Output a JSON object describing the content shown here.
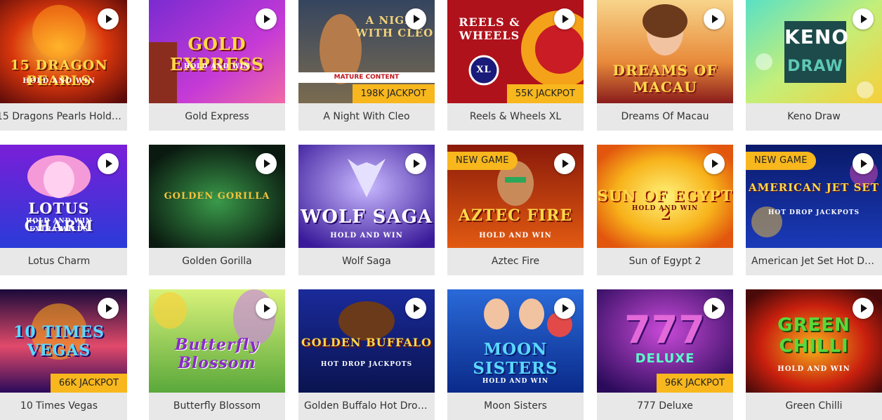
{
  "colors": {
    "tile_bg": "#e8e8e8",
    "badge": "#f7b71d",
    "text": "#333333"
  },
  "play_icon": "play-circle-icon",
  "games": [
    {
      "id": "g1",
      "title": "15 Dragons Pearls Hold a...",
      "art": "15 DRAGON PEARLS",
      "art_sub": "HOLD AND WIN"
    },
    {
      "id": "g2",
      "title": "Gold Express",
      "art": "GOLD EXPRESS",
      "art_sub": "HOLD AND WIN"
    },
    {
      "id": "g3",
      "title": "A Night With Cleo",
      "art": "A NIGHT WITH CLEO",
      "jackpot": "198K JACKPOT",
      "mature": "MATURE CONTENT"
    },
    {
      "id": "g4",
      "title": "Reels & Wheels XL",
      "art": "REELS & WHEELS",
      "art_sub": "XL",
      "jackpot": "55K JACKPOT"
    },
    {
      "id": "g5",
      "title": "Dreams Of Macau",
      "art": "DREAMS OF MACAU"
    },
    {
      "id": "g6",
      "title": "Keno Draw",
      "art": "KENO",
      "art_sub": "DRAW"
    },
    {
      "id": "g7",
      "title": "Lotus Charm",
      "art": "LOTUS CHARM",
      "art_sub": "HOLD AND WIN",
      "art_sub2": "EXTRA WILDS"
    },
    {
      "id": "g8",
      "title": "Golden Gorilla",
      "art": "GOLDEN GORILLA"
    },
    {
      "id": "g9",
      "title": "Wolf Saga",
      "art": "WOLF SAGA",
      "art_sub": "HOLD AND WIN"
    },
    {
      "id": "g10",
      "title": "Aztec Fire",
      "art": "AZTEC FIRE",
      "art_sub": "HOLD AND WIN",
      "new": "NEW GAME"
    },
    {
      "id": "g11",
      "title": "Sun of Egypt 2",
      "art": "SUN OF EGYPT 2",
      "art_sub": "HOLD AND WIN"
    },
    {
      "id": "g12",
      "title": "American Jet Set Hot Dr...",
      "art": "AMERICAN JET SET",
      "art_sub": "HOT DROP JACKPOTS",
      "new": "NEW GAME"
    },
    {
      "id": "g13",
      "title": "10 Times Vegas",
      "art": "10 TIMES VEGAS",
      "jackpot": "66K JACKPOT"
    },
    {
      "id": "g14",
      "title": "Butterfly Blossom",
      "art": "Butterfly Blossom"
    },
    {
      "id": "g15",
      "title": "Golden Buffalo Hot Drop...",
      "art": "GOLDEN BUFFALO",
      "art_sub": "HOT DROP JACKPOTS"
    },
    {
      "id": "g16",
      "title": "Moon Sisters",
      "art": "MOON SISTERS",
      "art_sub": "HOLD AND WIN"
    },
    {
      "id": "g17",
      "title": "777 Deluxe",
      "art": "777",
      "art_sub": "DELUXE",
      "jackpot": "96K JACKPOT"
    },
    {
      "id": "g18",
      "title": "Green Chilli",
      "art": "GREEN CHILLI",
      "art_sub": "HOLD AND WIN"
    }
  ]
}
